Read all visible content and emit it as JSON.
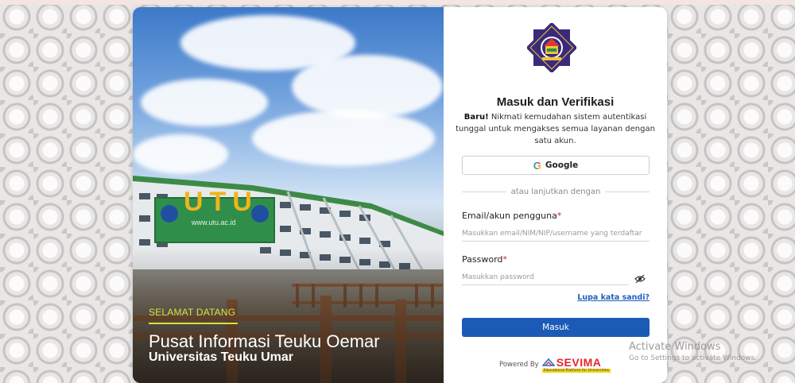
{
  "hero": {
    "welcome": "SELAMAT DATANG",
    "center_name": "Pusat Informasi Teuku Oemar",
    "university": "Universitas Teuku Umar",
    "building_sign": "UTU",
    "building_url": "www.utu.ac.id"
  },
  "form": {
    "title": "Masuk dan Verifikasi",
    "subtitle_bold": "Baru!",
    "subtitle_text": " Nikmati kemudahan sistem autentikasi tunggal untuk mengakses semua layanan dengan satu akun.",
    "google_label": "Google",
    "divider_text": "atau lanjutkan dengan",
    "email_label": "Email/akun pengguna",
    "email_placeholder": "Masukkan email/NIM/NIP/username yang terdaftar",
    "password_label": "Password",
    "password_placeholder": "Masukkan password",
    "required_mark": "*",
    "forgot_label": "Lupa kata sandi?",
    "submit_label": "Masuk",
    "powered_by": "Powered By",
    "sevima_name": "SEVIMA",
    "sevima_tagline": "Educational Platform for Universities"
  },
  "watermark": {
    "title": "Activate Windows",
    "subtitle": "Go to Settings to activate Windows."
  },
  "colors": {
    "primary_button": "#1c5bb5",
    "link": "#1f5fbf",
    "required": "#e02020",
    "welcome_accent": "#d8e042"
  },
  "icons": {
    "google": "google-g-icon",
    "password_toggle": "eye-slash-icon",
    "logo": "university-emblem-icon"
  }
}
